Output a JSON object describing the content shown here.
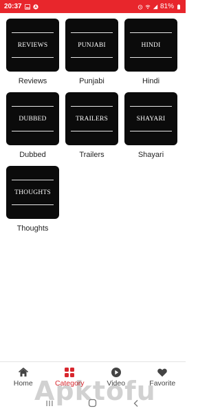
{
  "status_bar": {
    "time": "20:37",
    "battery": "81%",
    "background": "#e8262c"
  },
  "categories": [
    {
      "card_text": "REVIEWS",
      "label": "Reviews"
    },
    {
      "card_text": "PUNJABI",
      "label": "Punjabi"
    },
    {
      "card_text": "HINDI",
      "label": "Hindi"
    },
    {
      "card_text": "DUBBED",
      "label": "Dubbed"
    },
    {
      "card_text": "TRAILERS",
      "label": "Trailers"
    },
    {
      "card_text": "SHAYARI",
      "label": "Shayari"
    },
    {
      "card_text": "THOUGHTS",
      "label": "Thoughts"
    }
  ],
  "bottom_nav": {
    "items": [
      {
        "label": "Home",
        "icon": "home-icon"
      },
      {
        "label": "Category",
        "icon": "category-icon",
        "active": true
      },
      {
        "label": "Video",
        "icon": "play-icon"
      },
      {
        "label": "Favorite",
        "icon": "heart-icon"
      }
    ],
    "active_color": "#d8262d"
  },
  "watermark": "Apktofu"
}
